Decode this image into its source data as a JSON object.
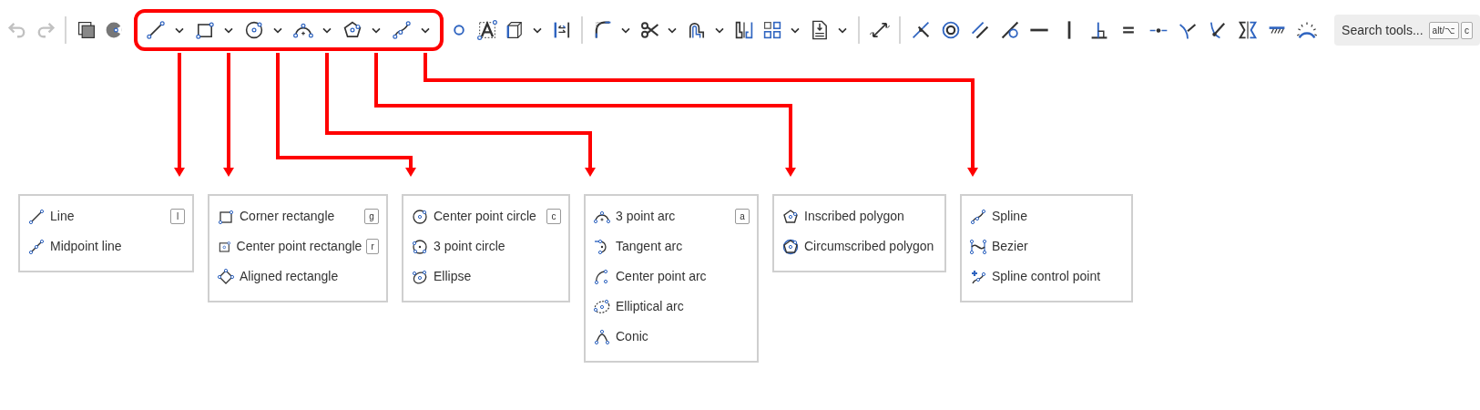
{
  "toolbar": {
    "items": [
      {
        "kind": "tool",
        "disabled": true
      },
      {
        "kind": "tool",
        "disabled": true
      },
      {
        "kind": "divider"
      },
      {
        "kind": "tool",
        "disabled": false
      },
      {
        "kind": "tool",
        "disabled": false
      },
      {
        "kind": "group",
        "items": [
          {
            "kind": "tool",
            "disabled": false
          },
          {
            "kind": "caret",
            "disabled": false
          },
          {
            "kind": "tool",
            "disabled": false
          },
          {
            "kind": "caret",
            "disabled": false
          },
          {
            "kind": "tool",
            "disabled": false
          },
          {
            "kind": "caret",
            "disabled": false
          },
          {
            "kind": "tool",
            "disabled": false
          },
          {
            "kind": "caret",
            "disabled": false
          },
          {
            "kind": "tool",
            "disabled": false
          },
          {
            "kind": "caret",
            "disabled": false
          },
          {
            "kind": "tool",
            "disabled": false
          },
          {
            "kind": "caret",
            "disabled": false
          }
        ]
      },
      {
        "kind": "tool",
        "disabled": false
      },
      {
        "kind": "tool",
        "disabled": false
      },
      {
        "kind": "tool",
        "disabled": false
      },
      {
        "kind": "caret",
        "disabled": false
      },
      {
        "kind": "tool",
        "disabled": false
      },
      {
        "kind": "divider"
      },
      {
        "kind": "tool",
        "disabled": false
      },
      {
        "kind": "caret",
        "disabled": false
      },
      {
        "kind": "tool",
        "disabled": false
      },
      {
        "kind": "caret",
        "disabled": false
      },
      {
        "kind": "tool",
        "disabled": false
      },
      {
        "kind": "caret",
        "disabled": false
      },
      {
        "kind": "tool",
        "disabled": false
      },
      {
        "kind": "tool",
        "disabled": false
      },
      {
        "kind": "caret",
        "disabled": false
      },
      {
        "kind": "tool",
        "disabled": false
      },
      {
        "kind": "caret",
        "disabled": false
      },
      {
        "kind": "divider"
      },
      {
        "kind": "tool",
        "disabled": false
      },
      {
        "kind": "divider"
      },
      {
        "kind": "tool",
        "disabled": false
      },
      {
        "kind": "tool",
        "disabled": false
      },
      {
        "kind": "tool",
        "disabled": false
      },
      {
        "kind": "tool",
        "disabled": false
      },
      {
        "kind": "tool",
        "disabled": false
      },
      {
        "kind": "tool",
        "disabled": false
      },
      {
        "kind": "tool",
        "disabled": false
      },
      {
        "kind": "tool",
        "disabled": false
      },
      {
        "kind": "tool",
        "disabled": false
      },
      {
        "kind": "tool",
        "disabled": false
      },
      {
        "kind": "tool",
        "disabled": false
      },
      {
        "kind": "tool",
        "disabled": false
      },
      {
        "kind": "tool",
        "disabled": false
      },
      {
        "kind": "tool",
        "disabled": false
      }
    ],
    "search": {
      "label": "Search tools...",
      "keys": [
        "alt/⌥",
        "c"
      ]
    }
  },
  "menus": [
    {
      "items": [
        {
          "label": "Line",
          "shortcut": "l"
        },
        {
          "label": "Midpoint line"
        }
      ]
    },
    {
      "items": [
        {
          "label": "Corner rectangle",
          "shortcut": "g"
        },
        {
          "label": "Center point rectangle",
          "shortcut": "r"
        },
        {
          "label": "Aligned rectangle"
        }
      ]
    },
    {
      "items": [
        {
          "label": "Center point circle",
          "shortcut": "c"
        },
        {
          "label": "3 point circle"
        },
        {
          "label": "Ellipse"
        }
      ]
    },
    {
      "items": [
        {
          "label": "3 point arc",
          "shortcut": "a"
        },
        {
          "label": "Tangent arc"
        },
        {
          "label": "Center point arc"
        },
        {
          "label": "Elliptical arc"
        },
        {
          "label": "Conic"
        }
      ]
    },
    {
      "items": [
        {
          "label": "Inscribed polygon"
        },
        {
          "label": "Circumscribed polygon"
        }
      ]
    },
    {
      "items": [
        {
          "label": "Spline"
        },
        {
          "label": "Bezier"
        },
        {
          "label": "Spline control point"
        }
      ]
    }
  ]
}
